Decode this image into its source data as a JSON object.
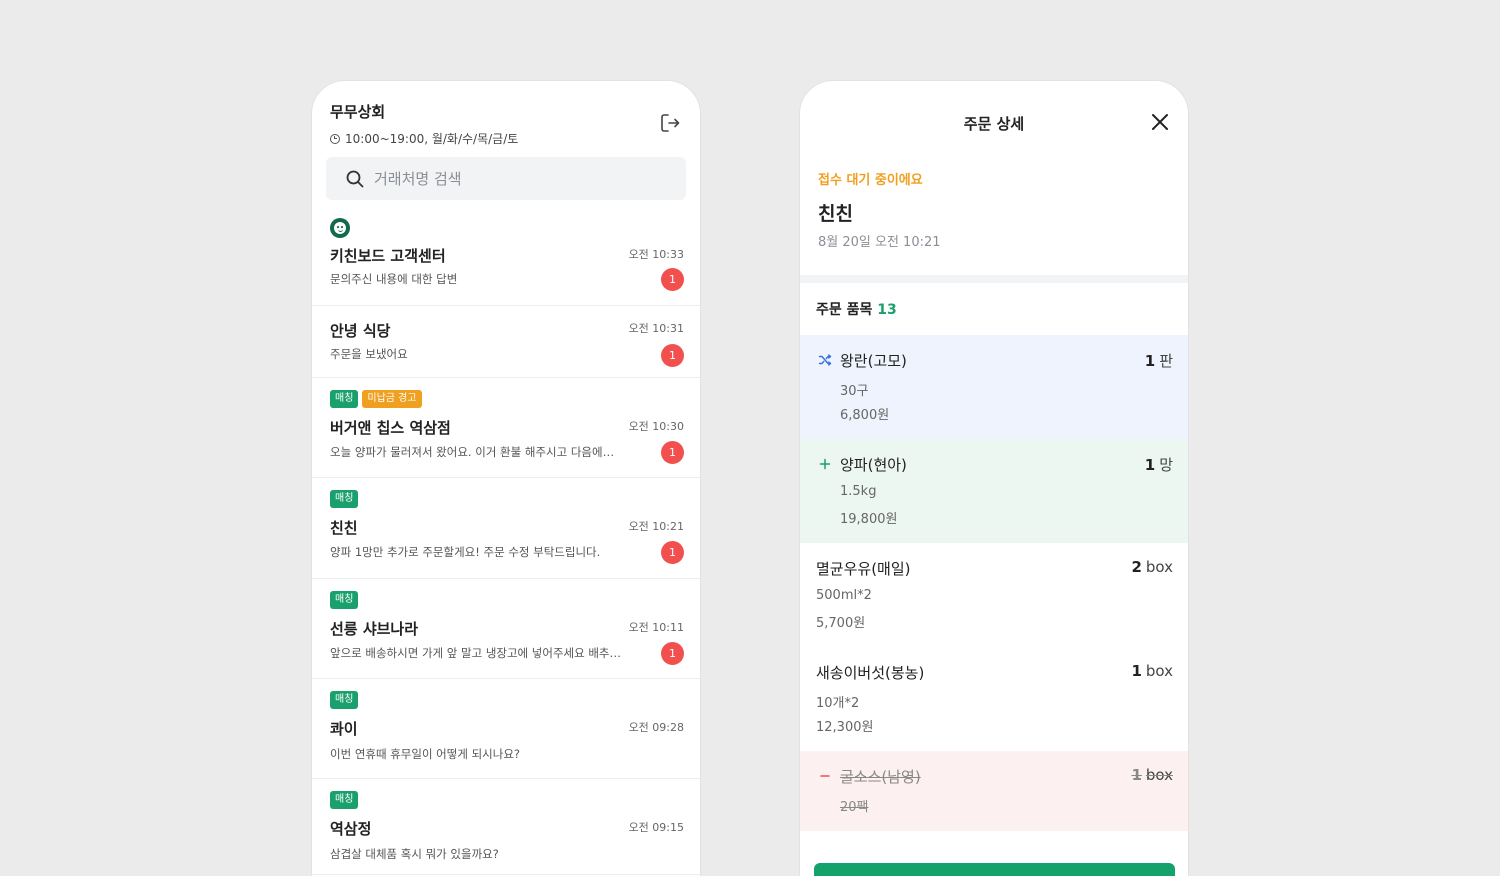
{
  "store": {
    "name": "무무상회",
    "hours": "10:00~19:00,  월/화/수/목/금/토"
  },
  "search": {
    "placeholder": "거래처명 검색"
  },
  "chats": [
    {
      "name": "키친보드 고객센터",
      "preview": "문의주신 내용에 대한 답변",
      "time": "오전 10:33",
      "unread": "1",
      "bot": true,
      "tags": []
    },
    {
      "name": "안녕 식당",
      "preview": "주문을 보냈어요",
      "time": "오전 10:31",
      "unread": "1",
      "bot": false,
      "tags": []
    },
    {
      "name": "버거앤 칩스 역삼점",
      "preview": "오늘 양파가 물러져서 왔어요. 이거 환불 해주시고 다음에는 더 좋은 걸로 보내주세요",
      "time": "오전 10:30",
      "unread": "1",
      "bot": false,
      "tags": [
        "매칭",
        "미납금 경고"
      ]
    },
    {
      "name": "친친",
      "preview": "양파 1망만 추가로 주문할게요! 주문 수정 부탁드립니다.",
      "time": "오전 10:21",
      "unread": "1",
      "bot": false,
      "tags": [
        "매칭"
      ]
    },
    {
      "name": "선릉 샤브나라",
      "preview": "앞으로 배송하시면 가게 앞 말고 냉장고에 넣어주세요 배추랑 양파",
      "time": "오전 10:11",
      "unread": "1",
      "bot": false,
      "tags": [
        "매칭"
      ]
    },
    {
      "name": "콰이",
      "preview": "이번 연휴때 휴무일이 어떻게 되시나요?",
      "time": "오전 09:28",
      "unread": "",
      "bot": false,
      "tags": [
        "매칭"
      ]
    },
    {
      "name": "역삼정",
      "preview": "삼겹살 대체품 혹시 뭐가 있을까요?",
      "time": "오전 09:15",
      "unread": "",
      "bot": false,
      "tags": [
        "매칭"
      ]
    }
  ],
  "detail": {
    "title": "주문 상세",
    "status": "접수 대기 중이에요",
    "customer": "친친",
    "date": "8월 20일   오전 10:21",
    "items_label": "주문 품목",
    "items_count": "13",
    "items": [
      {
        "name": "왕란(고모)",
        "spec": "30구",
        "price": "6,800원",
        "qty": "1",
        "unit": "판",
        "state": "changed",
        "icon": "shuffle-icon"
      },
      {
        "name": "양파(현아)",
        "spec": "1.5kg",
        "price": "19,800원",
        "qty": "1",
        "unit": "망",
        "state": "added",
        "icon": "plus-icon"
      },
      {
        "name": "멸균우유(매일)",
        "spec": "500ml*2",
        "price": "5,700원",
        "qty": "2",
        "unit": "box",
        "state": "normal",
        "icon": ""
      },
      {
        "name": "새송이버섯(봉농)",
        "spec": "10개*2",
        "price": "12,300원",
        "qty": "1",
        "unit": "box",
        "state": "normal",
        "icon": ""
      },
      {
        "name": "굴소스(남영)",
        "spec": "20팩",
        "price": "",
        "qty": "1",
        "unit": "box",
        "state": "removed",
        "icon": "minus-icon"
      }
    ]
  },
  "colors": {
    "accent_green": "#1aa06d",
    "warning_orange": "#f0a020",
    "unread_red": "#f1504e",
    "changed_bg": "#eef3fd",
    "added_bg": "#edf7f1",
    "removed_bg": "#fdf0f0"
  }
}
